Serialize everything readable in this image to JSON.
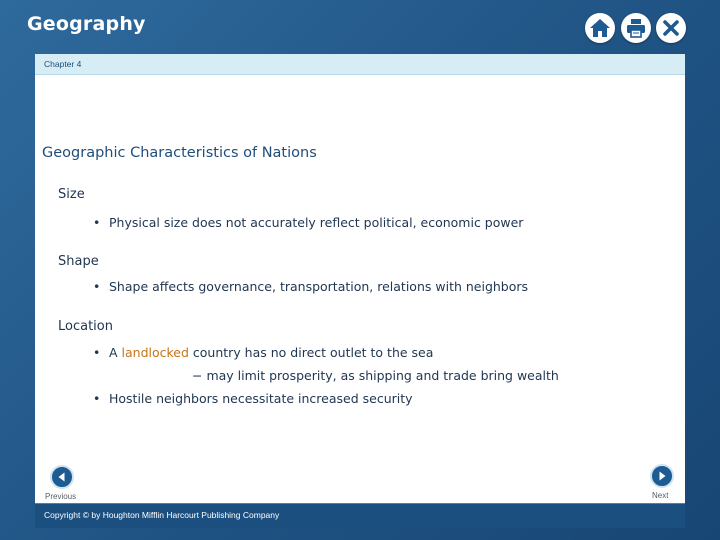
{
  "header": {
    "title": "Geography",
    "buttons": [
      {
        "icon": "home-icon",
        "label": "Home"
      },
      {
        "icon": "print-icon",
        "label": "Print"
      },
      {
        "icon": "close-icon",
        "label": "X"
      }
    ]
  },
  "chapter": {
    "label": "Chapter 4"
  },
  "slide": {
    "title": "Geographic Characteristics of Nations",
    "sections": [
      {
        "heading": "Size",
        "bullets": [
          "Physical size does not accurately reflect political, economic power"
        ]
      },
      {
        "heading": "Shape",
        "bullets": [
          "Shape affects governance, transportation, relations with neighbors"
        ]
      },
      {
        "heading": "Location",
        "bullet1_prefix": "A ",
        "bullet1_term": "landlocked",
        "bullet1_suffix": " country has no direct outlet to the sea",
        "sub_bullet": "− may limit prosperity, as shipping and trade bring wealth",
        "bullet2": "Hostile neighbors necessitate increased security"
      }
    ]
  },
  "navigation": {
    "previous_label": "Previous",
    "next_label": "Next"
  },
  "footer": {
    "copyright": "Copyright © by Houghton Mifflin Harcourt Publishing Company"
  },
  "colors": {
    "accent": "#1f5b93",
    "highlight": "#c5741a",
    "chapter_bar": "#d7edf6"
  }
}
